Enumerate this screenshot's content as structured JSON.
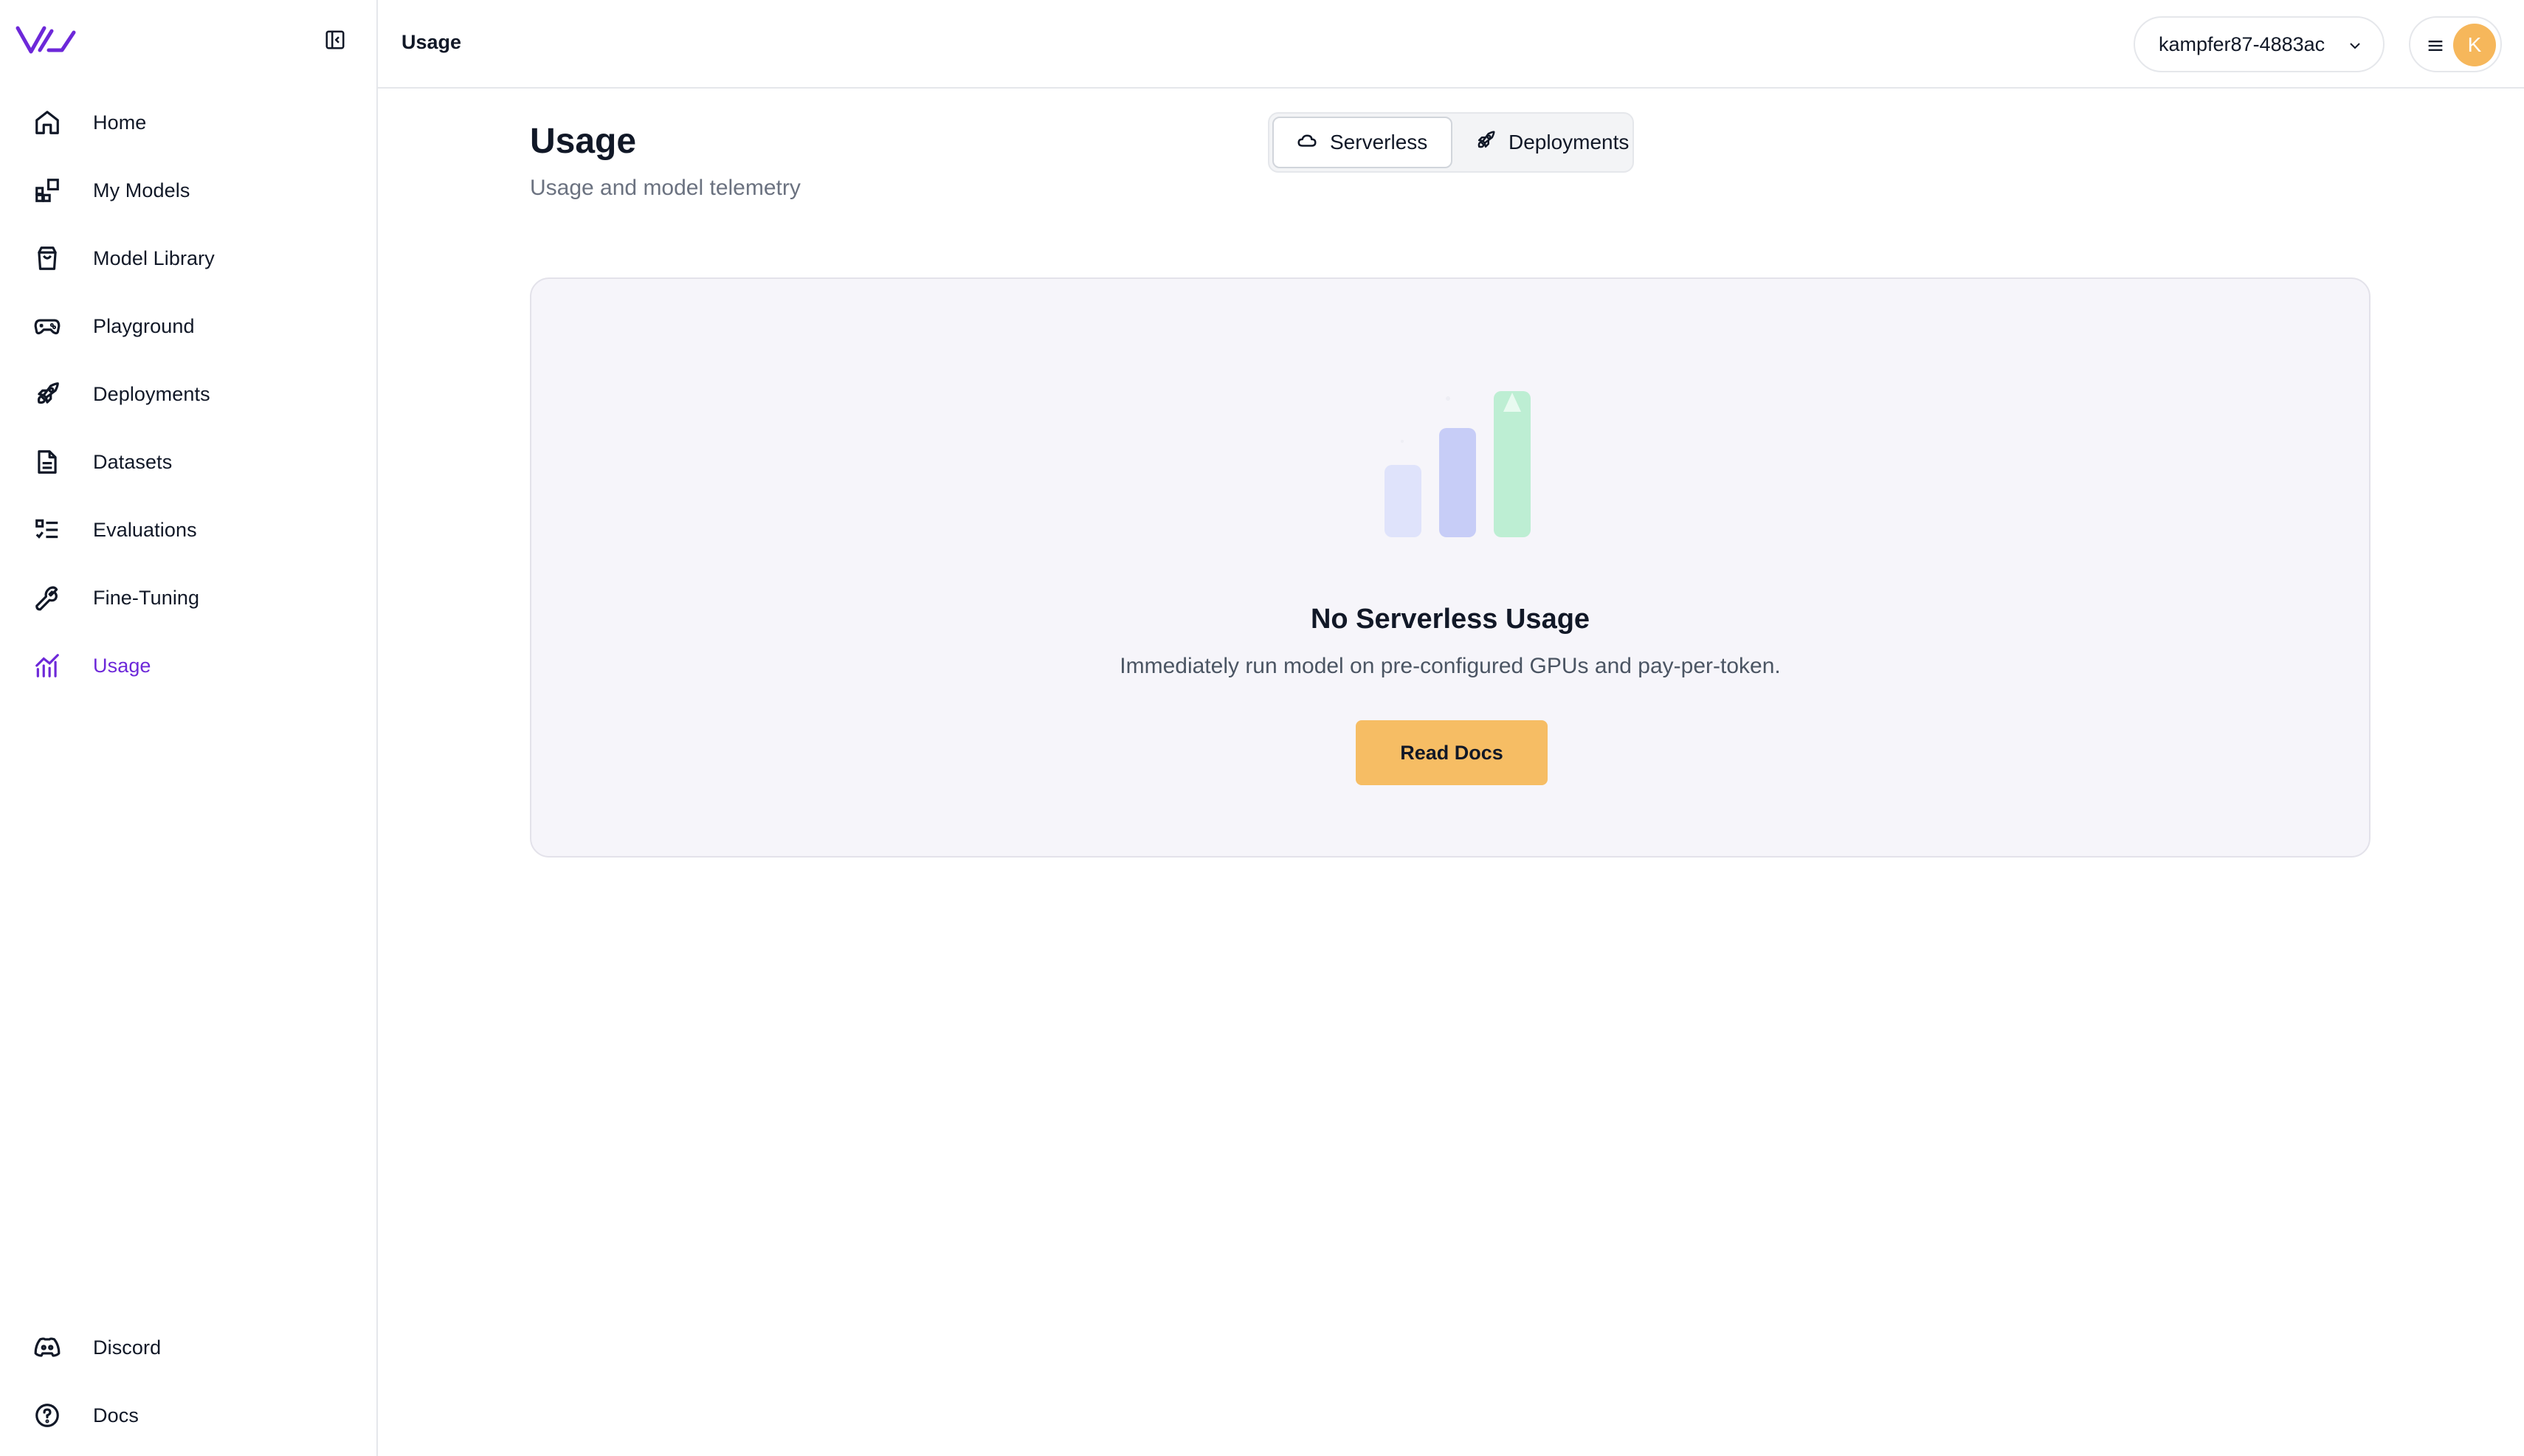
{
  "sidebar": {
    "items": [
      {
        "label": "Home",
        "icon": "home-icon"
      },
      {
        "label": "My Models",
        "icon": "models-grid-icon"
      },
      {
        "label": "Model Library",
        "icon": "shopping-bag-icon"
      },
      {
        "label": "Playground",
        "icon": "gamepad-icon"
      },
      {
        "label": "Deployments",
        "icon": "rocket-icon"
      },
      {
        "label": "Datasets",
        "icon": "document-icon"
      },
      {
        "label": "Evaluations",
        "icon": "checklist-icon"
      },
      {
        "label": "Fine-Tuning",
        "icon": "wrench-icon"
      },
      {
        "label": "Usage",
        "icon": "usage-chart-icon",
        "active": true
      }
    ],
    "bottom_items": [
      {
        "label": "Discord",
        "icon": "discord-icon"
      },
      {
        "label": "Docs",
        "icon": "help-circle-icon"
      }
    ]
  },
  "header": {
    "breadcrumb": "Usage",
    "account": "kampfer87-4883ac",
    "avatar_initial": "K"
  },
  "main": {
    "title": "Usage",
    "subtitle": "Usage and model telemetry",
    "tabs": [
      {
        "label": "Serverless",
        "icon": "cloud-icon",
        "selected": true
      },
      {
        "label": "Deployments",
        "icon": "rocket-icon",
        "selected": false
      }
    ],
    "empty_state": {
      "title": "No Serverless Usage",
      "description": "Immediately run model on pre-configured GPUs and pay-per-token.",
      "button_label": "Read Docs"
    }
  },
  "colors": {
    "accent": "#6d28d9",
    "button": "#f6bd64",
    "avatar": "#f6b75b",
    "card_bg": "#f6f5fa"
  }
}
